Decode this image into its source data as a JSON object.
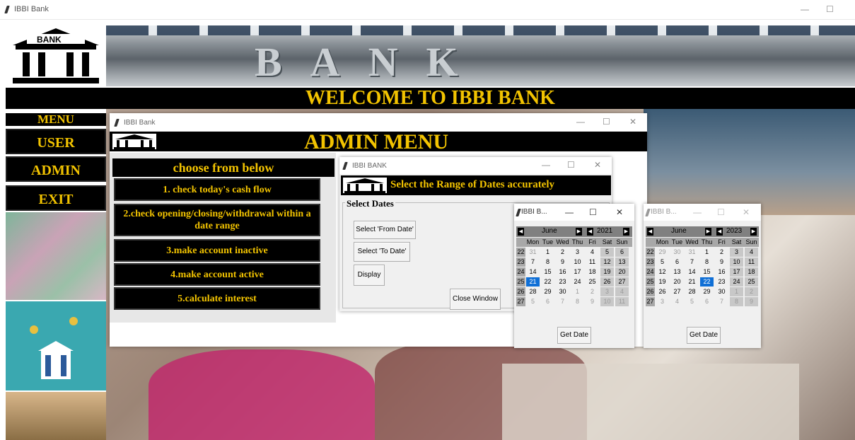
{
  "main_window": {
    "title": "IBBI Bank"
  },
  "header": {
    "logo_text": "BANK",
    "banner_text": "BANK",
    "welcome": "WELCOME TO IBBI BANK"
  },
  "menu": {
    "heading": "MENU",
    "items": [
      "USER",
      "ADMIN",
      "EXIT"
    ]
  },
  "admin_window": {
    "title": "IBBI Bank",
    "logo_text": "BANK",
    "heading": "ADMIN MENU",
    "choose_label": "choose from below",
    "options": [
      "1. check today's cash flow",
      "2.check opening/closing/withdrawal within a date range",
      "3.make account inactive",
      "4.make account active",
      "5.calculate interest"
    ]
  },
  "date_window": {
    "title": "IBBI BANK",
    "logo_text": "BANK",
    "heading": "Select the Range of Dates accurately",
    "group_label": "Select Dates",
    "from_button": "Select 'From Date'",
    "to_button": "Select 'To Date'",
    "display_button": "Display",
    "close_button": "Close Window"
  },
  "calendars": [
    {
      "title": "IBBI B...",
      "month": "June",
      "year": "2021",
      "weekday_headers": [
        "Mon",
        "Tue",
        "Wed",
        "Thu",
        "Fri",
        "Sat",
        "Sun"
      ],
      "weeks": [
        {
          "num": "22",
          "days": [
            "31",
            "1",
            "2",
            "3",
            "4",
            "5",
            "6"
          ]
        },
        {
          "num": "23",
          "days": [
            "7",
            "8",
            "9",
            "10",
            "11",
            "12",
            "13"
          ]
        },
        {
          "num": "24",
          "days": [
            "14",
            "15",
            "16",
            "17",
            "18",
            "19",
            "20"
          ]
        },
        {
          "num": "25",
          "days": [
            "21",
            "22",
            "23",
            "24",
            "25",
            "26",
            "27"
          ]
        },
        {
          "num": "26",
          "days": [
            "28",
            "29",
            "30",
            "1",
            "2",
            "3",
            "4"
          ]
        },
        {
          "num": "27",
          "days": [
            "5",
            "6",
            "7",
            "8",
            "9",
            "10",
            "11"
          ]
        }
      ],
      "selected_day": "21",
      "button": "Get Date"
    },
    {
      "title": "IBBI B...",
      "month": "June",
      "year": "2023",
      "weekday_headers": [
        "Mon",
        "Tue",
        "Wed",
        "Thu",
        "Fri",
        "Sat",
        "Sun"
      ],
      "weeks": [
        {
          "num": "22",
          "days": [
            "29",
            "30",
            "31",
            "1",
            "2",
            "3",
            "4"
          ]
        },
        {
          "num": "23",
          "days": [
            "5",
            "6",
            "7",
            "8",
            "9",
            "10",
            "11"
          ]
        },
        {
          "num": "24",
          "days": [
            "12",
            "13",
            "14",
            "15",
            "16",
            "17",
            "18"
          ]
        },
        {
          "num": "25",
          "days": [
            "19",
            "20",
            "21",
            "22",
            "23",
            "24",
            "25"
          ]
        },
        {
          "num": "26",
          "days": [
            "26",
            "27",
            "28",
            "29",
            "30",
            "1",
            "2"
          ]
        },
        {
          "num": "27",
          "days": [
            "3",
            "4",
            "5",
            "6",
            "7",
            "8",
            "9"
          ]
        }
      ],
      "selected_day": "22",
      "button": "Get Date"
    }
  ],
  "colors": {
    "menu_bg": "#000000",
    "menu_text": "#f2c300",
    "calendar_selected": "#0f6fd6"
  }
}
